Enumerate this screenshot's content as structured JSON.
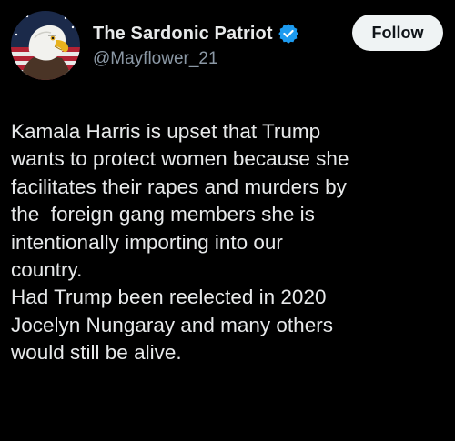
{
  "author": {
    "display_name": "The Sardonic Patriot",
    "handle": "@Mayflower_21",
    "verified": true,
    "avatar_icon": "bald-eagle-flag-avatar"
  },
  "follow_button": {
    "label": "Follow"
  },
  "tweet": {
    "lines": [
      "Kamala Harris is upset that Trump",
      "wants to protect women because she",
      "facilitates their rapes and murders by",
      "the  foreign gang members she is",
      "intentionally importing into our",
      "country.",
      "Had Trump been reelected in 2020",
      "Jocelyn Nungaray and many others",
      "would still be alive."
    ]
  },
  "colors": {
    "background": "#000000",
    "text": "#e7e9ea",
    "secondary_text": "#8b98a5",
    "verified_badge": "#1d9bf0",
    "button_bg": "#eff3f4",
    "button_text": "#0f1419"
  }
}
